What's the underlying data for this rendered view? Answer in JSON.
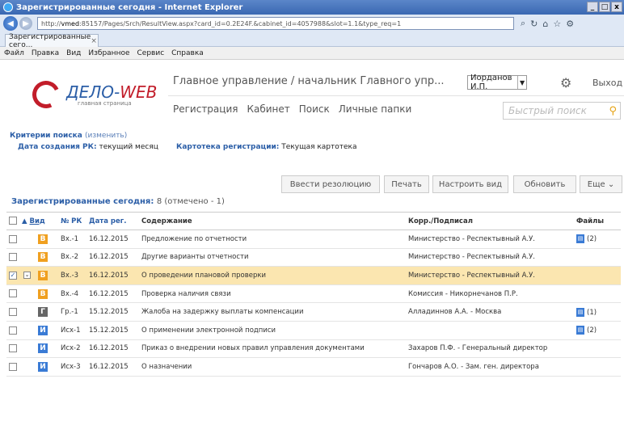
{
  "window": {
    "title": "Зарегистрированные сегодня - Internet Explorer",
    "controls": [
      "_",
      "□",
      "x"
    ]
  },
  "address": {
    "url_host": "vmed",
    "url_rest": "85157/Pages/Srch/ResultView.aspx?card_id=0.2E24F.&cabinet_id=4057988&slot=1.1&type_req=1"
  },
  "tabs": [
    {
      "label": "Зарегистрированные сего..."
    }
  ],
  "menubar": [
    "Файл",
    "Правка",
    "Вид",
    "Избранное",
    "Сервис",
    "Справка"
  ],
  "header": {
    "logo_main": "ДЕЛО-",
    "logo_accent": "WEB",
    "logo_sub": "главная страница",
    "org_title": "Главное управление / начальник Главного упр...",
    "user": "Иорданов И.П.",
    "logout": "Выход"
  },
  "nav": [
    "Регистрация",
    "Кабинет",
    "Поиск",
    "Личные папки"
  ],
  "quick_search": {
    "placeholder": "Быстрый поиск"
  },
  "criteria": {
    "title": "Критерии поиска",
    "change": "(изменить)",
    "items": [
      {
        "key": "Дата создания РК:",
        "value": "текущий месяц"
      },
      {
        "key": "Картотека регистрации:",
        "value": "Текущая картотека"
      }
    ]
  },
  "toolbar": {
    "resolution": "Ввести резолюцию",
    "print": "Печать",
    "customize": "Настроить вид",
    "refresh": "Обновить",
    "more": "Еще"
  },
  "summary": {
    "label": "Зарегистрированные сегодня:",
    "count": "8 (отмечено - 1)"
  },
  "table": {
    "columns": [
      "",
      "Вид",
      "№ РК",
      "Дата рег.",
      "Содержание",
      "Корр./Подписал",
      "Файлы"
    ],
    "rows": [
      {
        "checked": false,
        "kind": "В",
        "kind_color": "#f0a020",
        "num": "Вх.-1",
        "date": "16.12.2015",
        "content": "Предложение по отчетности",
        "corr": "Министерство - Респектывный А.У.",
        "files": "(2)"
      },
      {
        "checked": false,
        "kind": "В",
        "kind_color": "#f0a020",
        "num": "Вх.-2",
        "date": "16.12.2015",
        "content": "Другие варианты отчетности",
        "corr": "Министерство - Респектывный А.У.",
        "files": ""
      },
      {
        "checked": true,
        "kind": "В",
        "kind_color": "#f0a020",
        "num": "Вх.-3",
        "date": "16.12.2015",
        "content": "О проведении плановой проверки",
        "corr": "Министерство - Респектывный А.У.",
        "files": ""
      },
      {
        "checked": false,
        "kind": "В",
        "kind_color": "#f0a020",
        "num": "Вх.-4",
        "date": "16.12.2015",
        "content": "Проверка наличия связи",
        "corr": "Комиссия - Никорнечанов П.Р.",
        "files": ""
      },
      {
        "checked": false,
        "kind": "Г",
        "kind_color": "#666666",
        "num": "Гр.-1",
        "date": "15.12.2015",
        "content": "Жалоба на задержку выплаты компенсации",
        "corr": "Алладиннов А.А. - Москва",
        "files": "(1)"
      },
      {
        "checked": false,
        "kind": "И",
        "kind_color": "#3a7bd5",
        "num": "Исх-1",
        "date": "15.12.2015",
        "content": "О применении электронной подписи",
        "corr": "",
        "files": "(2)"
      },
      {
        "checked": false,
        "kind": "И",
        "kind_color": "#3a7bd5",
        "num": "Исх-2",
        "date": "16.12.2015",
        "content": "Приказ о внедрении новых правил управления документами",
        "corr": "Захаров П.Ф. - Генеральный директор",
        "files": ""
      },
      {
        "checked": false,
        "kind": "И",
        "kind_color": "#3a7bd5",
        "num": "Исх-3",
        "date": "16.12.2015",
        "content": "О назначении",
        "corr": "Гончаров А.О. - Зам. ген. директора",
        "files": ""
      }
    ]
  }
}
